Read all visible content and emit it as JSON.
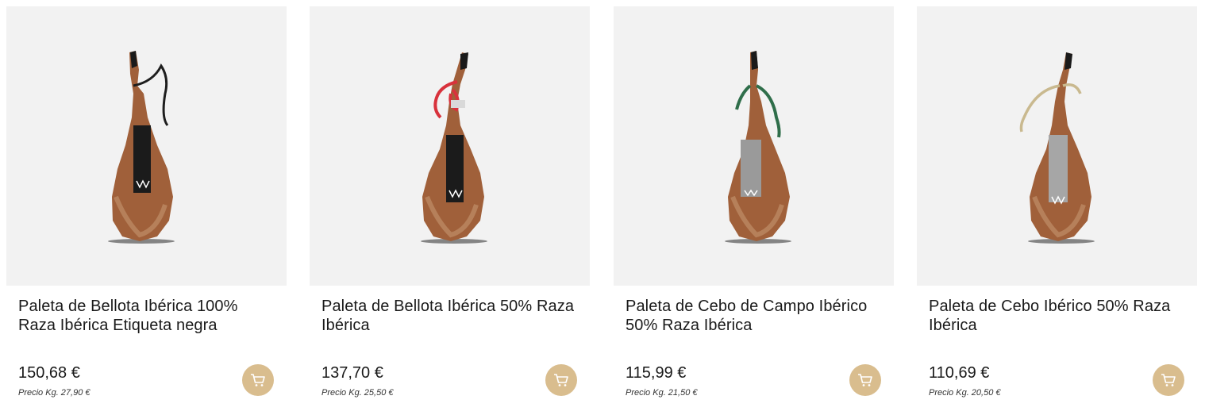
{
  "products": [
    {
      "title": "Paleta de Bellota Ibérica 100% Raza Ibérica Etiqueta negra",
      "price": "150,68 €",
      "price_per_kg": "Precio Kg. 27,90 €",
      "label_color": "#1b1b1b",
      "rope_color": "#1e1e1e",
      "icon": "cart-icon"
    },
    {
      "title": "Paleta de Bellota Ibérica 50% Raza Ibérica",
      "price": "137,70 €",
      "price_per_kg": "Precio Kg. 25,50 €",
      "label_color": "#1b1b1b",
      "rope_color": "#d8323c",
      "icon": "cart-icon"
    },
    {
      "title": "Paleta de Cebo de Campo Ibérico 50% Raza Ibérica",
      "price": "115,99 €",
      "price_per_kg": "Precio Kg. 21,50 €",
      "label_color": "#9a9a9a",
      "rope_color": "#2f6e4a",
      "icon": "cart-icon"
    },
    {
      "title": "Paleta de Cebo Ibérico 50% Raza Ibérica",
      "price": "110,69 €",
      "price_per_kg": "Precio Kg. 20,50 €",
      "label_color": "#a6a6a6",
      "rope_color": "#c9b98f",
      "icon": "cart-icon"
    }
  ],
  "colors": {
    "image_background": "#f2f2f2",
    "cart_button": "#d9bd8e",
    "ham": "#a0603a"
  }
}
